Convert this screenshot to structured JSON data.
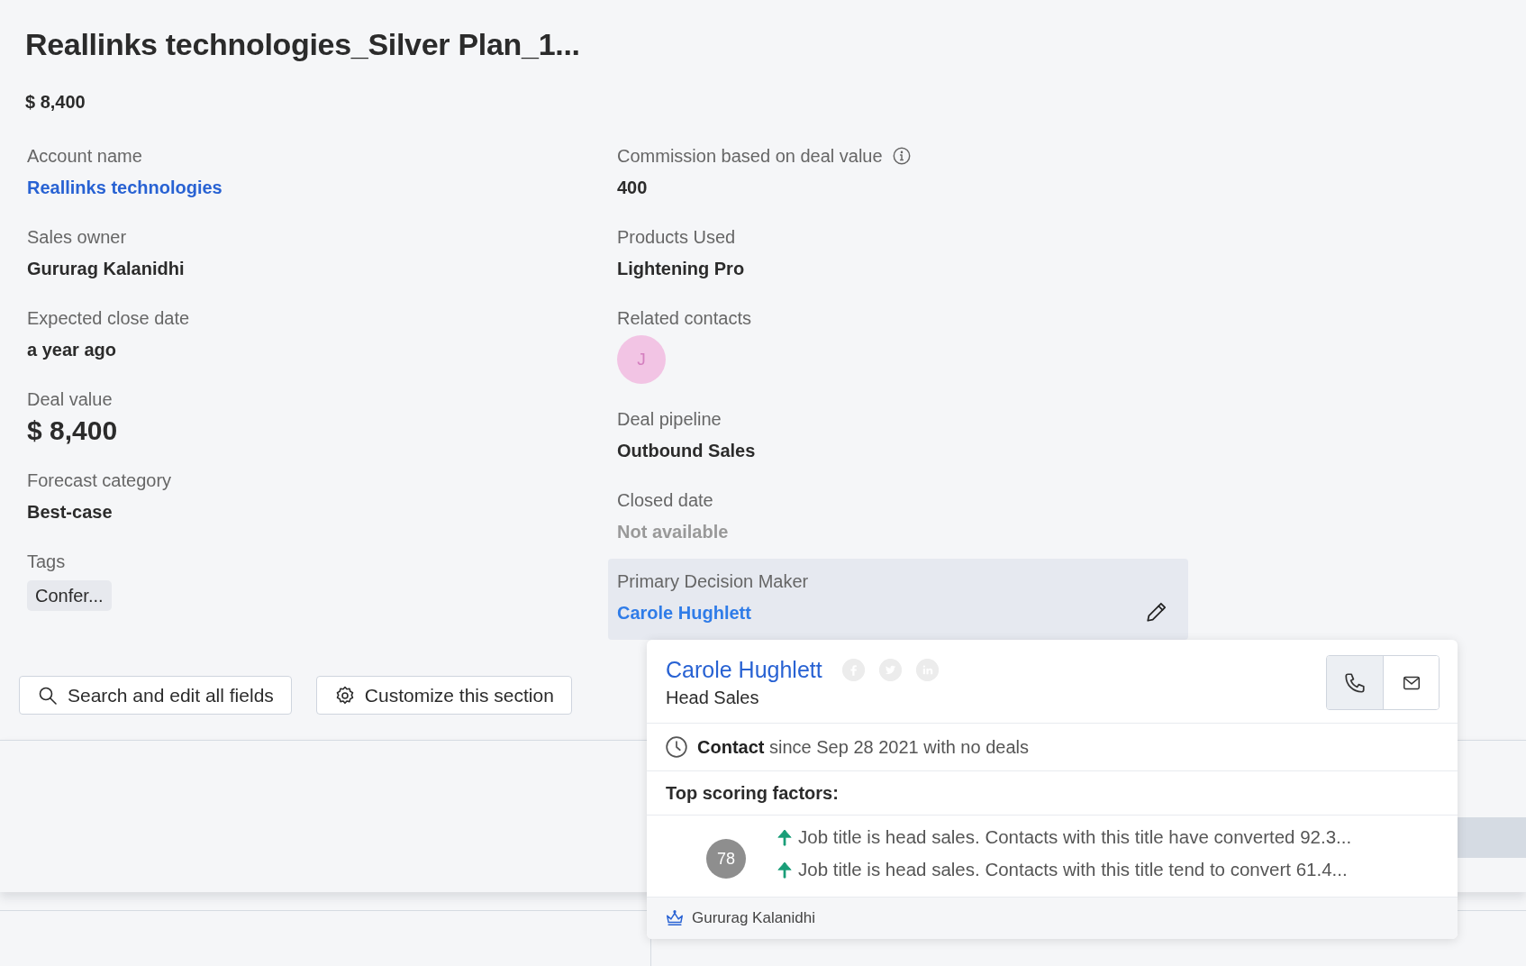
{
  "deal": {
    "title": "Reallinks technologies_Silver Plan_1...",
    "amount": "$ 8,400"
  },
  "left_fields": [
    {
      "kind": "link",
      "label": "Account name",
      "value": "Reallinks technologies"
    },
    {
      "kind": "text",
      "label": "Sales owner",
      "value": "Gururag Kalanidhi"
    },
    {
      "kind": "text",
      "label": "Expected close date",
      "value": "a year ago"
    },
    {
      "kind": "large",
      "label": "Deal value",
      "value": "$ 8,400"
    },
    {
      "kind": "text",
      "label": "Forecast category",
      "value": "Best-case"
    },
    {
      "kind": "tags",
      "label": "Tags",
      "tags": [
        "Confer..."
      ]
    }
  ],
  "right_fields": [
    {
      "kind": "text",
      "label": "Commission based on deal value",
      "value": "400",
      "info_icon": true
    },
    {
      "kind": "text",
      "label": "Products Used",
      "value": "Lightening Pro"
    },
    {
      "kind": "avatars",
      "label": "Related contacts",
      "contacts": [
        {
          "initial": "J",
          "color": "#f2c4e4"
        }
      ]
    },
    {
      "kind": "text",
      "label": "Deal pipeline",
      "value": "Outbound Sales"
    },
    {
      "kind": "muted",
      "label": "Closed date",
      "value": "Not available"
    },
    {
      "kind": "link",
      "label": "Primary Decision Maker",
      "value": "Carole Hughlett",
      "highlighted": true
    }
  ],
  "buttons": [
    {
      "kind": "search",
      "label": "Search and edit all fields"
    },
    {
      "kind": "gear",
      "label": "Customize this section"
    }
  ],
  "contact_card": {
    "name": "Carole Hughlett",
    "job_title": "Head Sales",
    "actions": [
      {
        "kind": "phone",
        "selected": true
      },
      {
        "kind": "email",
        "selected": false
      }
    ],
    "since": "**Contact** since Sep 28 2021 with no deals",
    "scoring_title": "Top scoring factors:",
    "score": "78",
    "factors": [
      {
        "kind": "up",
        "text": "Job title is head sales. Contacts with this title have converted 92.3..."
      },
      {
        "kind": "up",
        "text": "Job title is head sales. Contacts with this title tend to convert 61.4..."
      }
    ],
    "owner": "Gururag Kalanidhi"
  }
}
